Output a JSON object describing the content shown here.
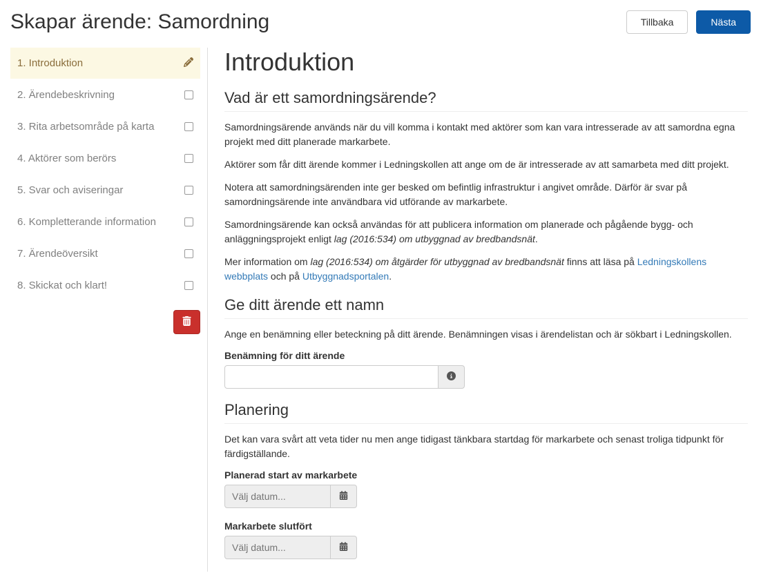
{
  "header": {
    "title": "Skapar ärende: Samordning",
    "back_label": "Tillbaka",
    "next_label": "Nästa"
  },
  "sidebar": {
    "steps": [
      {
        "label": "1. Introduktion",
        "active": true,
        "icon": "edit"
      },
      {
        "label": "2. Ärendebeskrivning",
        "active": false,
        "icon": "checkbox"
      },
      {
        "label": "3. Rita arbetsområde på karta",
        "active": false,
        "icon": "checkbox"
      },
      {
        "label": "4. Aktörer som berörs",
        "active": false,
        "icon": "checkbox"
      },
      {
        "label": "5. Svar och aviseringar",
        "active": false,
        "icon": "checkbox"
      },
      {
        "label": "6. Kompletterande information",
        "active": false,
        "icon": "checkbox"
      },
      {
        "label": "7. Ärendeöversikt",
        "active": false,
        "icon": "checkbox"
      },
      {
        "label": "8. Skickat och klart!",
        "active": false,
        "icon": "checkbox"
      }
    ]
  },
  "main": {
    "title": "Introduktion",
    "section1": {
      "heading": "Vad är ett samordningsärende?",
      "p1": "Samordningsärende används när du vill komma i kontakt med aktörer som kan vara intresserade av att samordna egna projekt med ditt planerade markarbete.",
      "p2": "Aktörer som får ditt ärende kommer i Ledningskollen att ange om de är intresserade av att samarbeta med ditt projekt.",
      "p3": "Notera att samordningsärenden inte ger besked om befintlig infrastruktur i angivet område. Därför är svar på samordningsärende inte användbara vid utförande av markarbete.",
      "p4_a": "Samordningsärende kan också användas för att publicera information om planerade och pågående bygg- och anläggningsprojekt enligt ",
      "p4_em": "lag (2016:534) om utbyggnad av bredbandsnät",
      "p4_b": ".",
      "p5_a": "Mer information om ",
      "p5_em": "lag (2016:534) om åtgärder för utbyggnad av bredbandsnät",
      "p5_b": " finns att läsa på ",
      "p5_link1": "Ledningskollens webbplats",
      "p5_c": " och på ",
      "p5_link2": "Utbyggnadsportalen",
      "p5_d": "."
    },
    "section2": {
      "heading": "Ge ditt ärende ett namn",
      "p1": "Ange en benämning eller beteckning på ditt ärende. Benämningen visas i ärendelistan och är sökbart i Ledningskollen.",
      "field_label": "Benämning för ditt ärende"
    },
    "section3": {
      "heading": "Planering",
      "p1": "Det kan vara svårt att veta tider nu men ange tidigast tänkbara startdag för markarbete och senast troliga tidpunkt för färdigställande.",
      "start_label": "Planerad start av markarbete",
      "start_placeholder": "Välj datum...",
      "end_label": "Markarbete slutfört",
      "end_placeholder": "Välj datum..."
    }
  }
}
